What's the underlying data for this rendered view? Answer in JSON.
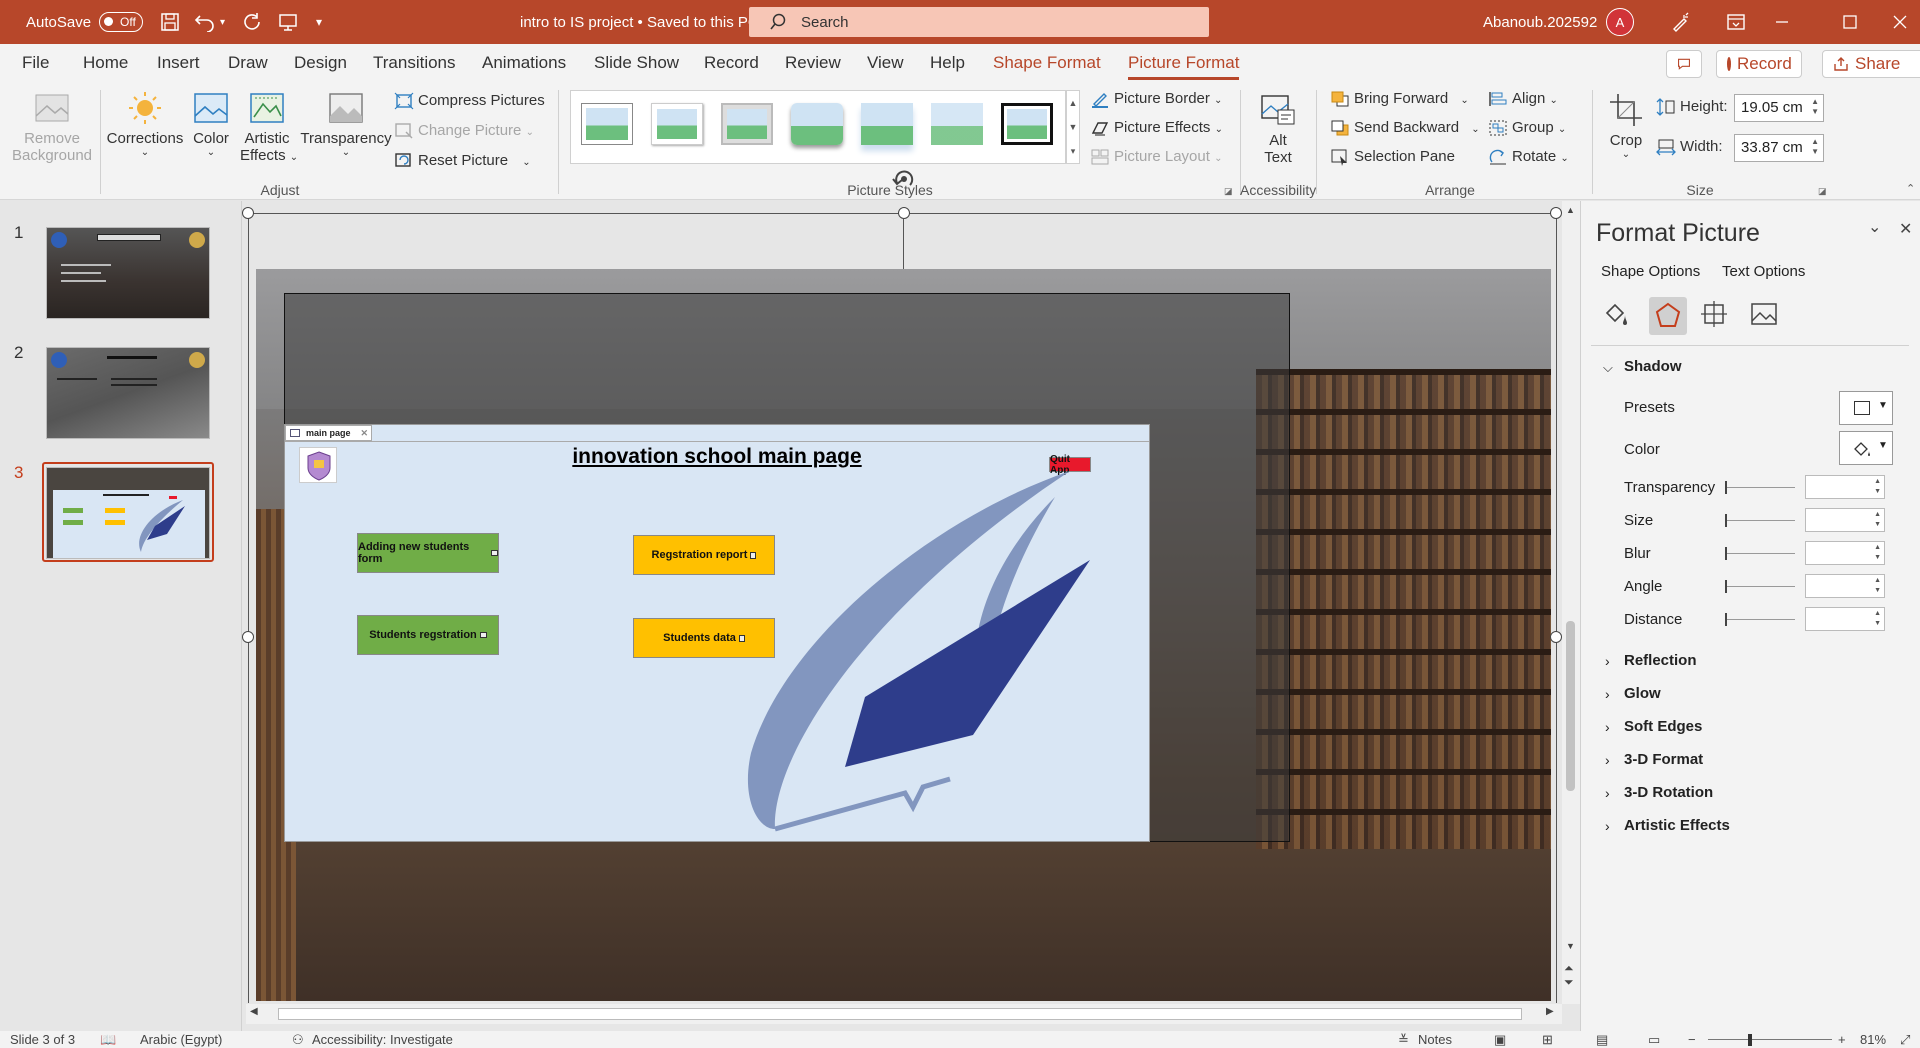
{
  "titlebar": {
    "autosave_label": "AutoSave",
    "autosave_state": "Off",
    "doc_title": "intro to IS project • Saved to this PC",
    "search_placeholder": "Search",
    "user_name": "Abanoub.202592",
    "avatar_initial": "A"
  },
  "tabs": [
    "File",
    "Home",
    "Insert",
    "Draw",
    "Design",
    "Transitions",
    "Animations",
    "Slide Show",
    "Record",
    "Review",
    "View",
    "Help",
    "Shape Format",
    "Picture Format"
  ],
  "active_tab": "Picture Format",
  "record_button": "Record",
  "share_button": "Share",
  "ribbon": {
    "adjust": {
      "remove_bg_1": "Remove",
      "remove_bg_2": "Background",
      "corrections": "Corrections",
      "color": "Color",
      "artistic_1": "Artistic",
      "artistic_2": "Effects",
      "transparency": "Transparency",
      "compress": "Compress Pictures",
      "change": "Change Picture",
      "reset": "Reset Picture",
      "group_label": "Adjust"
    },
    "styles": {
      "group_label": "Picture Styles",
      "border": "Picture Border",
      "effects": "Picture Effects",
      "layout": "Picture Layout"
    },
    "accessibility": {
      "alt_1": "Alt",
      "alt_2": "Text",
      "group_label": "Accessibility"
    },
    "arrange": {
      "bring_forward": "Bring Forward",
      "send_backward": "Send Backward",
      "selection_pane": "Selection Pane",
      "align": "Align",
      "group": "Group",
      "rotate": "Rotate",
      "group_label": "Arrange"
    },
    "size": {
      "crop": "Crop",
      "height_label": "Height:",
      "height_value": "19.05 cm",
      "width_label": "Width:",
      "width_value": "33.87 cm",
      "group_label": "Size"
    }
  },
  "slides": [
    {
      "num": "1"
    },
    {
      "num": "2"
    },
    {
      "num": "3"
    }
  ],
  "active_slide": "3",
  "form": {
    "tab_label": "main page",
    "title": "innovation school main page",
    "quit_button": "Quit App",
    "btn_add_students": "Adding new students form",
    "btn_students_reg": "Students regstration",
    "btn_reg_report": "Regstration report",
    "btn_students_data": "Students data",
    "colors": {
      "green": "#70ad47",
      "yellow": "#ffc000",
      "red": "#e8192c",
      "navy": "#2e3d8b",
      "lightblue": "#8296bf"
    }
  },
  "format_pane": {
    "title": "Format Picture",
    "tab_shape": "Shape Options",
    "tab_text": "Text Options",
    "shadow": "Shadow",
    "presets": "Presets",
    "color": "Color",
    "transparency": "Transparency",
    "size": "Size",
    "blur": "Blur",
    "angle": "Angle",
    "distance": "Distance",
    "sections": [
      "Reflection",
      "Glow",
      "Soft Edges",
      "3-D Format",
      "3-D Rotation",
      "Artistic Effects"
    ]
  },
  "statusbar": {
    "slide_info": "Slide 3 of 3",
    "language": "Arabic (Egypt)",
    "accessibility": "Accessibility: Investigate",
    "notes": "Notes",
    "zoom": "81%"
  }
}
